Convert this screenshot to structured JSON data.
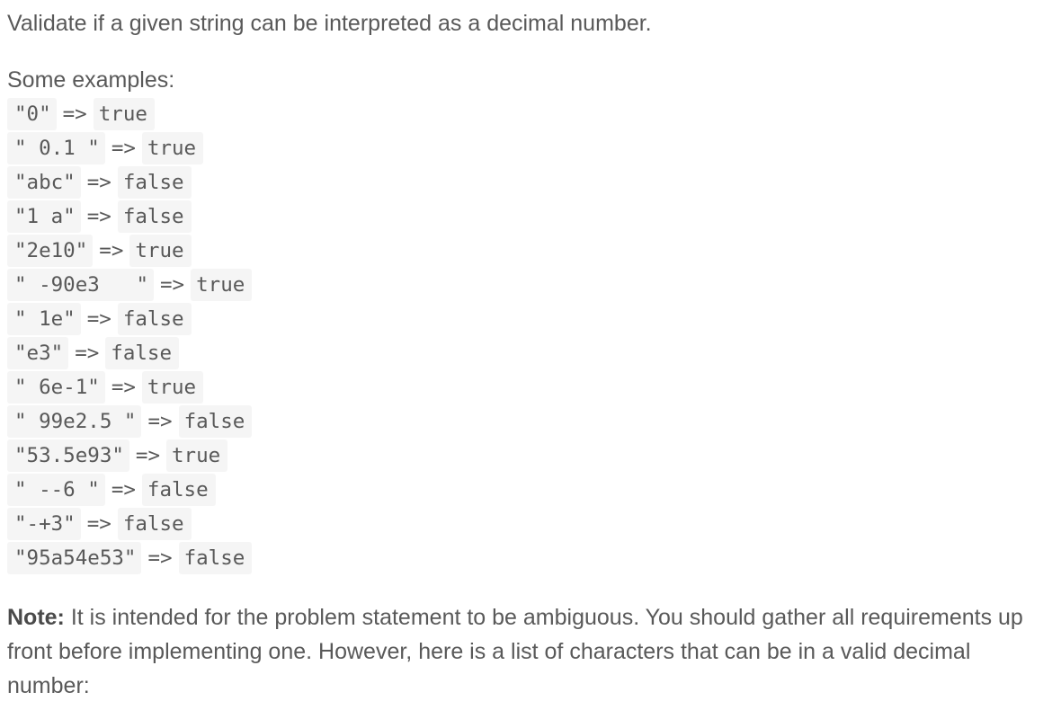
{
  "intro": "Validate if a given string can be interpreted as a decimal number.",
  "examples_label": "Some examples:",
  "arrow": "=>",
  "examples": [
    {
      "input": "\"0\"",
      "result": "true"
    },
    {
      "input": "\" 0.1 \"",
      "result": "true"
    },
    {
      "input": "\"abc\"",
      "result": "false"
    },
    {
      "input": "\"1 a\"",
      "result": "false"
    },
    {
      "input": "\"2e10\"",
      "result": "true"
    },
    {
      "input": "\" -90e3   \"",
      "result": "true"
    },
    {
      "input": "\" 1e\"",
      "result": "false"
    },
    {
      "input": "\"e3\"",
      "result": "false"
    },
    {
      "input": "\" 6e-1\"",
      "result": "true"
    },
    {
      "input": "\" 99e2.5 \"",
      "result": "false"
    },
    {
      "input": "\"53.5e93\"",
      "result": "true"
    },
    {
      "input": "\" --6 \"",
      "result": "false"
    },
    {
      "input": "\"-+3\"",
      "result": "false"
    },
    {
      "input": "\"95a54e53\"",
      "result": "false"
    }
  ],
  "note": {
    "label": "Note:",
    "text": "It is intended for the problem statement to be ambiguous. You should gather all requirements up front before implementing one. However, here is a list of characters that can be in a valid decimal number:"
  }
}
